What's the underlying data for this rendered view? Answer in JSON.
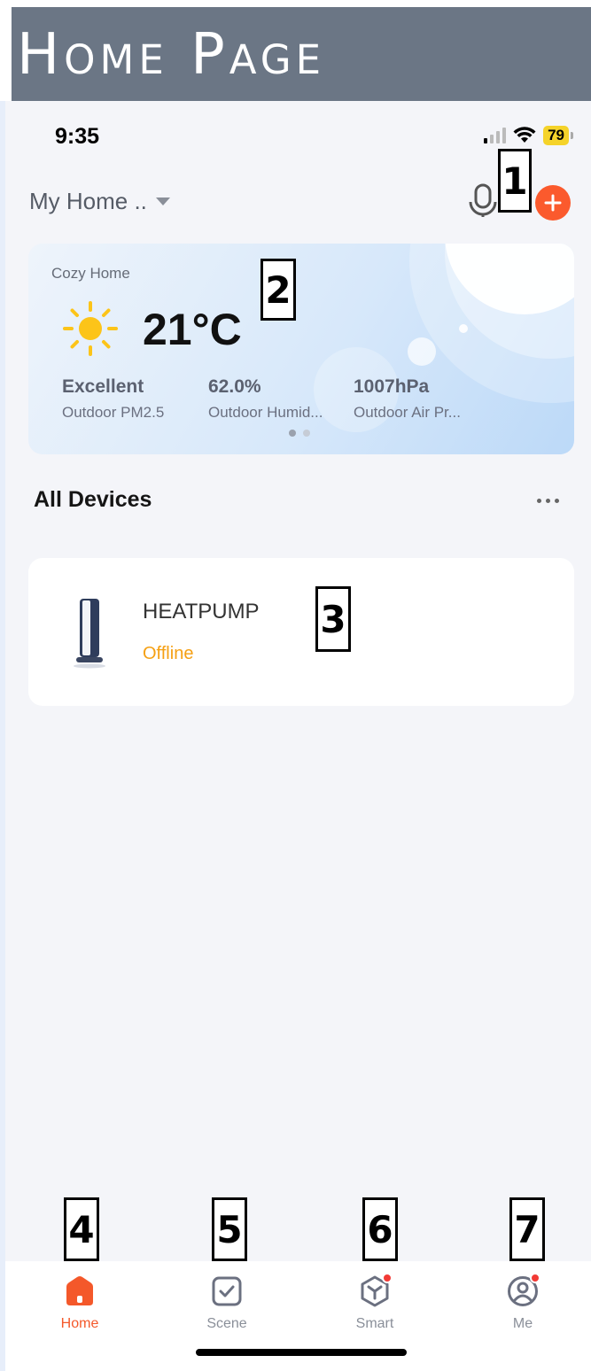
{
  "banner": {
    "title": "Home Page"
  },
  "status_bar": {
    "time": "9:35",
    "battery": "79"
  },
  "header": {
    "home_name": "My Home ..",
    "add_symbol": "+"
  },
  "weather": {
    "location": "Cozy Home",
    "temperature": "21°C",
    "stats": [
      {
        "value": "Excellent",
        "label": "Outdoor PM2.5"
      },
      {
        "value": "62.0%",
        "label": "Outdoor Humid..."
      },
      {
        "value": "1007hPa",
        "label": "Outdoor Air Pr..."
      }
    ]
  },
  "devices": {
    "title": "All Devices",
    "items": [
      {
        "name": "HEATPUMP",
        "status": "Offline"
      }
    ]
  },
  "tabs": [
    {
      "label": "Home",
      "active": true
    },
    {
      "label": "Scene",
      "active": false
    },
    {
      "label": "Smart",
      "active": false
    },
    {
      "label": "Me",
      "active": false
    }
  ],
  "annotations": [
    "1",
    "2",
    "3",
    "4",
    "5",
    "6",
    "7"
  ],
  "colors": {
    "accent": "#f4582a",
    "offline": "#f5a014",
    "banner": "#6b7685"
  },
  "icons": [
    "signal-icon",
    "wifi-icon",
    "battery-icon",
    "caret-down-icon",
    "microphone-icon",
    "plus-icon",
    "sun-icon",
    "more-icon",
    "home-icon",
    "scene-icon",
    "smart-icon",
    "me-icon"
  ]
}
